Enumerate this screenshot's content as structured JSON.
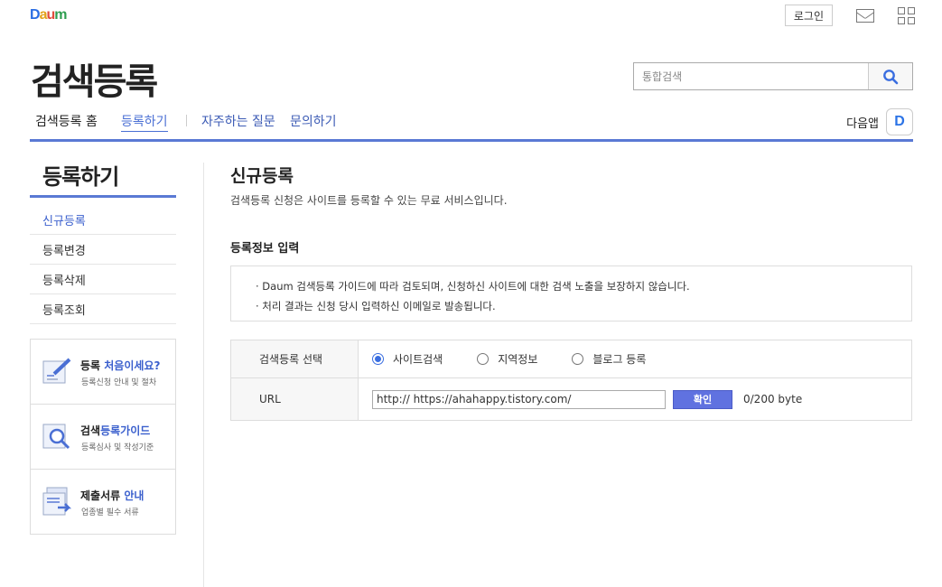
{
  "header": {
    "logo_letters": [
      {
        "ch": "D",
        "color": "#2b6ee3"
      },
      {
        "ch": "a",
        "color": "#e3a21a"
      },
      {
        "ch": "u",
        "color": "#e04c3c"
      },
      {
        "ch": "m",
        "color": "#2e9e4f"
      }
    ],
    "login_label": "로그인",
    "page_title": "검색등록",
    "search_placeholder": "통합검색"
  },
  "nav": {
    "home": "검색등록 홈",
    "register": "등록하기",
    "faq": "자주하는 질문",
    "inquiry": "문의하기",
    "app_label": "다음앱",
    "app_icon_letter": "D"
  },
  "sidebar": {
    "title": "등록하기",
    "items": [
      {
        "label": "신규등록",
        "active": true
      },
      {
        "label": "등록변경",
        "active": false
      },
      {
        "label": "등록삭제",
        "active": false
      },
      {
        "label": "등록조회",
        "active": false
      }
    ],
    "info": [
      {
        "title_a": "등록 ",
        "title_hl": "처음이세요?",
        "title_b": "",
        "sub": "등록신청 안내 및 절차"
      },
      {
        "title_a": "검색",
        "title_hl": "등록가이드",
        "title_b": "",
        "sub": "등록심사 및 작성기준"
      },
      {
        "title_a": "제출서류 ",
        "title_hl": "안내",
        "title_b": "",
        "sub": "업종별 필수 서류"
      }
    ]
  },
  "main": {
    "title": "신규등록",
    "desc": "검색등록 신청은 사이트를 등록할 수 있는 무료 서비스입니다.",
    "section_title": "등록정보 입력",
    "notices": [
      "· Daum 검색등록 가이드에 따라 검토되며, 신청하신 사이트에 대한 검색 노출을 보장하지 않습니다.",
      "· 처리 결과는 신청 당시 입력하신 이메일로 발송됩니다."
    ],
    "form": {
      "type_label": "검색등록 선택",
      "options": [
        {
          "label": "사이트검색",
          "selected": true
        },
        {
          "label": "지역정보",
          "selected": false
        },
        {
          "label": "블로그 등록",
          "selected": false
        }
      ],
      "url_label": "URL",
      "url_value": "http:// https://ahahappy.tistory.com/",
      "confirm_label": "확인",
      "byte_count": "0/200 byte"
    }
  },
  "colors": {
    "accent": "#5a79d4",
    "link": "#3a5fcd",
    "button": "#6072e0"
  }
}
